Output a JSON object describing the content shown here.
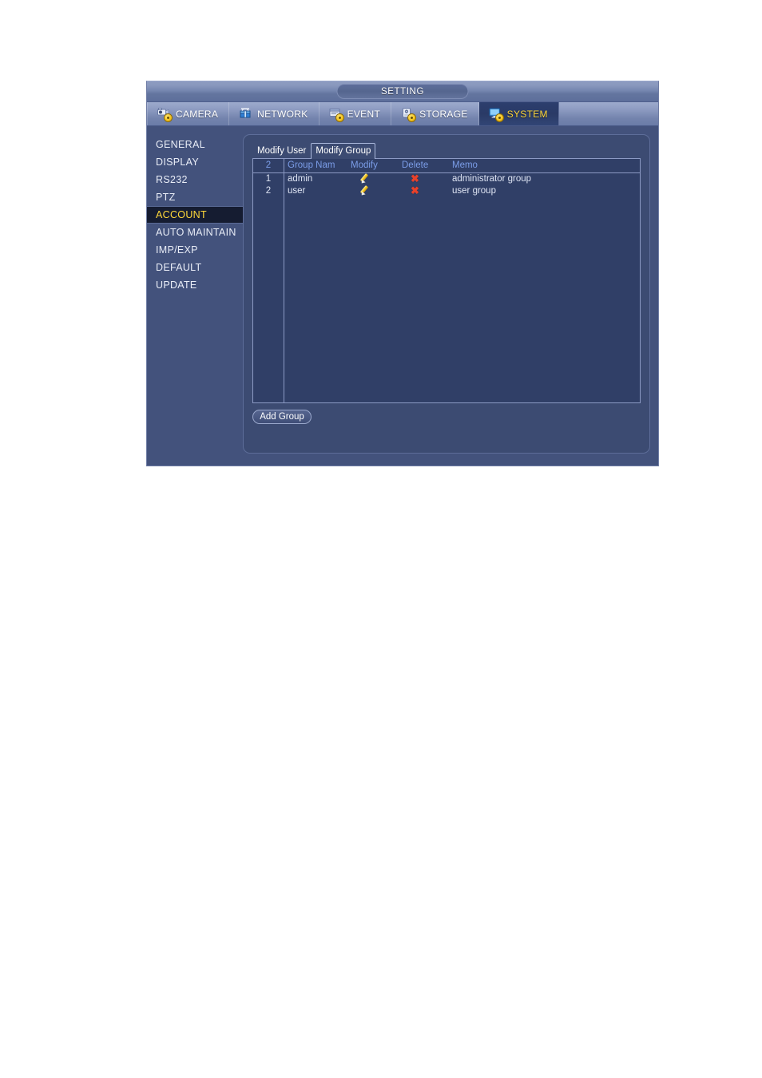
{
  "window": {
    "title": "SETTING"
  },
  "top_tabs": [
    {
      "label": "CAMERA",
      "icon": "camera-gear-icon",
      "active": false
    },
    {
      "label": "NETWORK",
      "icon": "network-icon",
      "active": false
    },
    {
      "label": "EVENT",
      "icon": "event-gear-icon",
      "active": false
    },
    {
      "label": "STORAGE",
      "icon": "storage-gear-icon",
      "active": false
    },
    {
      "label": "SYSTEM",
      "icon": "system-gear-icon",
      "active": true
    }
  ],
  "sidebar": {
    "items": [
      {
        "label": "GENERAL",
        "selected": false
      },
      {
        "label": "DISPLAY",
        "selected": false
      },
      {
        "label": "RS232",
        "selected": false
      },
      {
        "label": "PTZ",
        "selected": false
      },
      {
        "label": "ACCOUNT",
        "selected": true
      },
      {
        "label": "AUTO MAINTAIN",
        "selected": false
      },
      {
        "label": "IMP/EXP",
        "selected": false
      },
      {
        "label": "DEFAULT",
        "selected": false
      },
      {
        "label": "UPDATE",
        "selected": false
      }
    ]
  },
  "sub_tabs": [
    {
      "label": "Modify User",
      "active": false
    },
    {
      "label": "Modify Group",
      "active": true
    }
  ],
  "table": {
    "headers": {
      "index": "2",
      "group_name": "Group Nam",
      "modify": "Modify",
      "delete": "Delete",
      "memo": "Memo"
    },
    "rows": [
      {
        "index": "1",
        "group_name": "admin",
        "modify": "pencil-icon",
        "delete": "x-icon",
        "memo": "administrator group"
      },
      {
        "index": "2",
        "group_name": "user",
        "modify": "pencil-icon",
        "delete": "x-icon",
        "memo": "user group"
      }
    ]
  },
  "buttons": {
    "add_group": "Add Group"
  },
  "colors": {
    "accent_yellow": "#ffd83a",
    "header_blue": "#7b9de8",
    "delete_red": "#e8412a",
    "window_frame": "#43527c",
    "panel_bg": "#3c4b72",
    "table_bg": "#303f67",
    "selected_bg": "#151c31"
  }
}
